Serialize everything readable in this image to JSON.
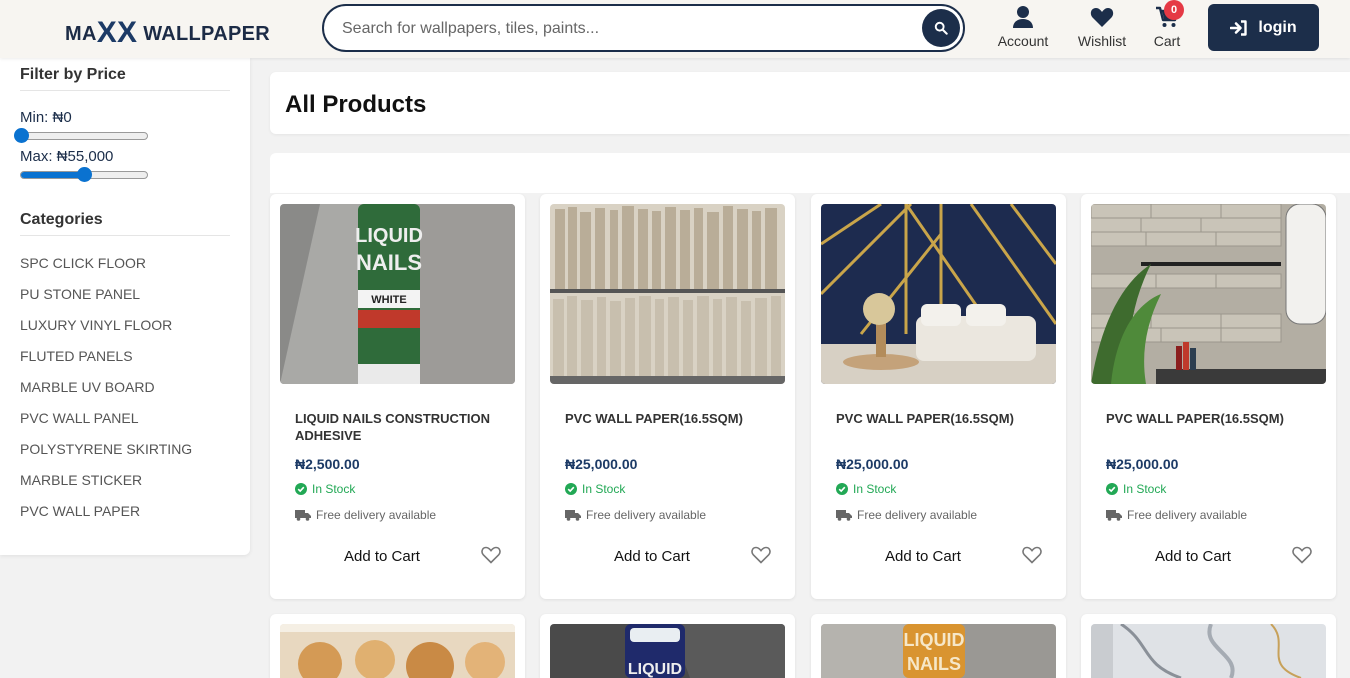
{
  "header": {
    "logo_prefix": "MA",
    "logo_xx": "XX",
    "logo_suffix": " WALLPAPER",
    "search_placeholder": "Search for wallpapers, tiles, paints...",
    "nav": [
      {
        "label": "Account",
        "icon": "user-icon"
      },
      {
        "label": "Wishlist",
        "icon": "heart-icon"
      },
      {
        "label": "Cart",
        "icon": "cart-icon"
      }
    ],
    "cart_count": "0",
    "login_label": "login"
  },
  "sidebar": {
    "price_title": "Filter by Price",
    "min_label": "Min: ₦0",
    "max_label": "Max: ₦55,000",
    "min_fraction": 0.0,
    "max_fraction": 0.5,
    "categories_title": "Categories",
    "categories": [
      "SPC CLICK FLOOR",
      "PU STONE PANEL",
      "LUXURY VINYL FLOOR",
      "FLUTED PANELS",
      "MARBLE UV BOARD",
      "PVC WALL PANEL",
      "POLYSTYRENE SKIRTING",
      "MARBLE STICKER",
      "PVC WALL PAPER"
    ]
  },
  "main": {
    "title": "All Products",
    "products": [
      {
        "name": "LIQUID NAILS CONSTRUCTION ADHESIVE",
        "price": "₦2,500.00",
        "stock": "In Stock",
        "delivery": "Free delivery available",
        "add_label": "Add to Cart"
      },
      {
        "name": "PVC WALL PAPER(16.5sqm)",
        "price": "₦25,000.00",
        "stock": "In Stock",
        "delivery": "Free delivery available",
        "add_label": "Add to Cart"
      },
      {
        "name": "PVC WALL PAPER(16.5sqm)",
        "price": "₦25,000.00",
        "stock": "In Stock",
        "delivery": "Free delivery available",
        "add_label": "Add to Cart"
      },
      {
        "name": "PVC WALL PAPER(16.5sqm)",
        "price": "₦25,000.00",
        "stock": "In Stock",
        "delivery": "Free delivery available",
        "add_label": "Add to Cart"
      }
    ]
  },
  "colors": {
    "brand": "#1c2e4a",
    "stock_green": "#22a855",
    "badge_red": "#e53945",
    "slider_blue": "#0a72d0"
  }
}
